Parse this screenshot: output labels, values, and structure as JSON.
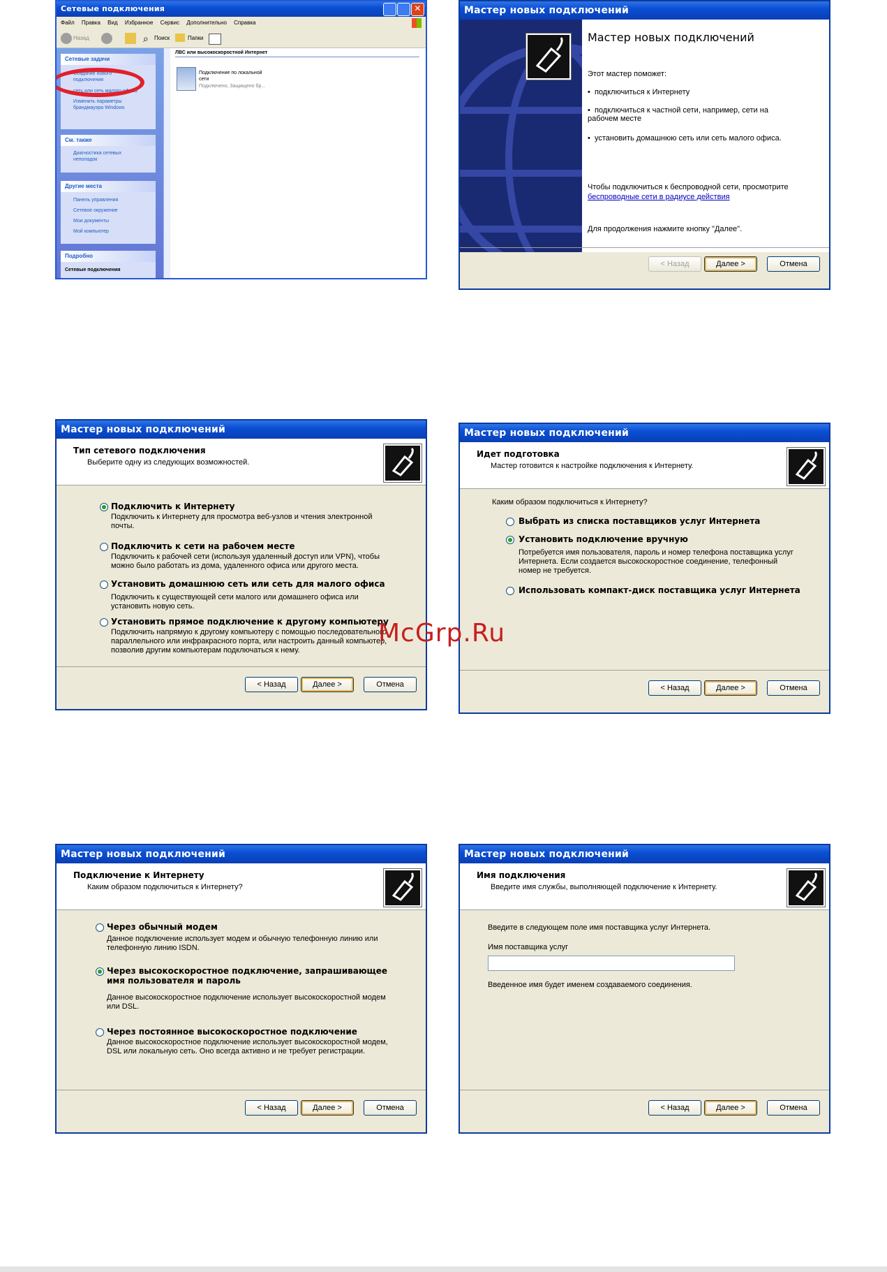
{
  "explorer": {
    "title": "Сетевые подключения",
    "menu": [
      "Файл",
      "Правка",
      "Вид",
      "Избранное",
      "Сервис",
      "Дополнительно",
      "Справка"
    ],
    "toolbar": {
      "back": "Назад",
      "search": "Поиск",
      "folders": "Папки"
    },
    "tasks_title": "Сетевые задачи",
    "tasks": [
      "Создание нового подключения",
      "сеть или сеть малого офиса",
      "Изменить параметры брандмауэра Windows"
    ],
    "see_also_title": "См. также",
    "see_also": [
      "Диагностика сетевых неполадок"
    ],
    "other_title": "Другие места",
    "other": [
      "Панель управления",
      "Сетевое окружение",
      "Мои документы",
      "Мой компьютер"
    ],
    "details_title": "Подробно",
    "details_item": "Сетевые подключения",
    "group_header": "ЛВС или высокоскоростной Интернет",
    "connection_name": "Подключение по локальной сети",
    "connection_status": "Подключено, Защищено бр..."
  },
  "wiz1": {
    "title": "Мастер новых подключений",
    "heading": "Мастер новых подключений",
    "intro": "Этот мастер поможет:",
    "bullets": [
      "подключиться к Интернету",
      "подключиться к частной сети, например, сети на рабочем месте",
      "установить домашнюю сеть или сеть малого офиса."
    ],
    "wireless_text": "Чтобы подключиться к беспроводной сети, просмотрите",
    "wireless_link": "беспроводные сети в радиусе действия",
    "continue_text": "Для продолжения нажмите кнопку \"Далее\"."
  },
  "wiz2": {
    "title": "Мастер новых подключений",
    "header_title": "Тип сетевого подключения",
    "header_sub": "Выберите одну из следующих возможностей.",
    "options": [
      {
        "label": "Подключить к Интернету",
        "desc": "Подключить к Интернету для просмотра веб-узлов и чтения электронной почты."
      },
      {
        "label": "Подключить к сети на рабочем месте",
        "desc": "Подключить к рабочей сети (используя удаленный доступ или VPN), чтобы можно было работать из дома, удаленного офиса или другого места."
      },
      {
        "label": "Установить домашнюю сеть или сеть для малого офиса",
        "desc": "Подключить к существующей сети малого или домашнего офиса или установить новую сеть."
      },
      {
        "label": "Установить прямое подключение к другому компьютеру",
        "desc": "Подключить напрямую к другому компьютеру с помощью последовательного, параллельного или инфракрасного порта, или настроить данный компьютер, позволив другим компьютерам подключаться к нему."
      }
    ]
  },
  "wiz3": {
    "title": "Мастер новых подключений",
    "header_title": "Идет подготовка",
    "header_sub": "Мастер готовится к настройке подключения к Интернету.",
    "question": "Каким образом подключиться к Интернету?",
    "options": [
      {
        "label": "Выбрать из списка поставщиков услуг Интернета",
        "desc": ""
      },
      {
        "label": "Установить подключение вручную",
        "desc": "Потребуется имя пользователя, пароль и номер телефона поставщика услуг Интернета. Если создается высокоскоростное соединение, телефонный номер не требуется."
      },
      {
        "label": "Использовать компакт-диск поставщика услуг Интернета",
        "desc": ""
      }
    ]
  },
  "wiz4": {
    "title": "Мастер новых подключений",
    "header_title": "Подключение к Интернету",
    "header_sub": "Каким образом подключиться к Интернету?",
    "options": [
      {
        "label": "Через обычный модем",
        "desc": "Данное подключение использует модем и обычную телефонную линию или телефонную линию ISDN."
      },
      {
        "label": "Через высокоскоростное подключение, запрашивающее имя пользователя и пароль",
        "desc": "Данное высокоскоростное подключение использует высокоскоростной модем или DSL."
      },
      {
        "label": "Через постоянное высокоскоростное подключение",
        "desc": "Данное высокоскоростное подключение использует высокоскоростной модем, DSL или локальную сеть. Оно всегда активно и не требует регистрации."
      }
    ]
  },
  "wiz5": {
    "title": "Мастер новых подключений",
    "header_title": "Имя подключения",
    "header_sub": "Введите имя службы, выполняющей подключение к Интернету.",
    "prompt": "Введите в следующем поле имя поставщика услуг Интернета.",
    "field_label": "Имя поставщика услуг",
    "field_value": "",
    "note": "Введенное имя будет именем создаваемого соединения."
  },
  "buttons": {
    "back": "< Назад",
    "next": "Далее >",
    "cancel": "Отмена"
  },
  "watermark": "McGrp.Ru",
  "colors": {
    "xp_blue": "#0a4fd4",
    "dialog_bg": "#ece9d8",
    "highlight_ring": "#e0202a",
    "watermark": "#c81e1e"
  }
}
